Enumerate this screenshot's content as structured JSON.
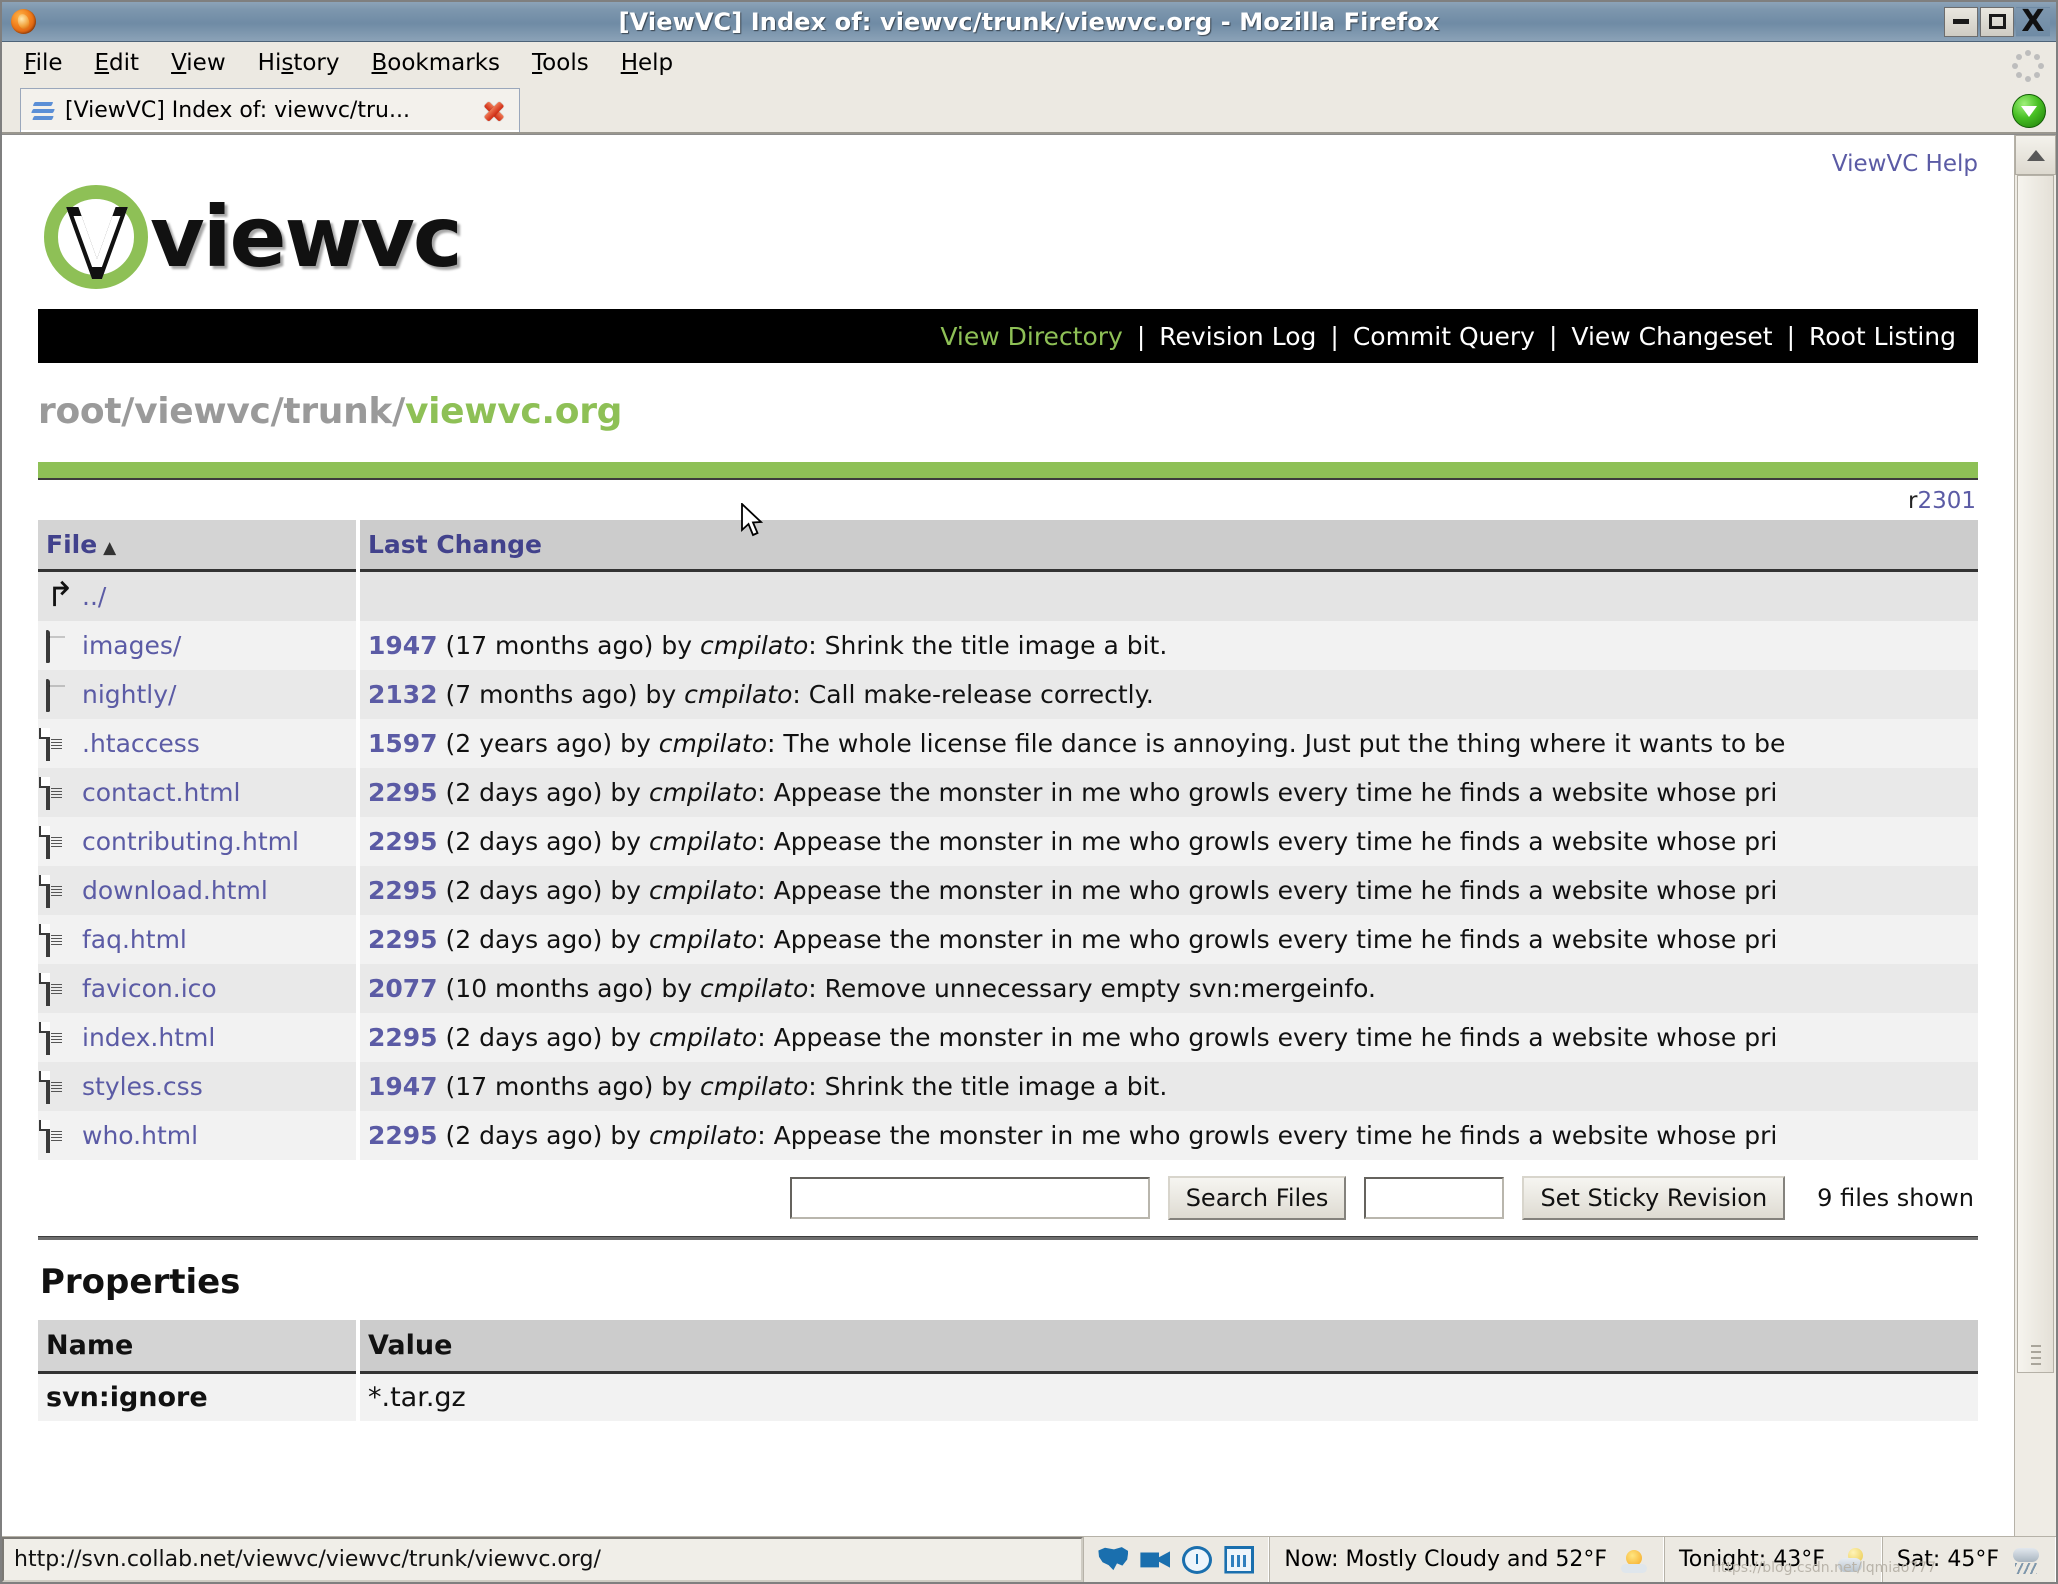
{
  "window": {
    "title": "[ViewVC] Index of: viewvc/trunk/viewvc.org - Mozilla Firefox",
    "minimize_label": "Minimize",
    "maximize_label": "Maximize",
    "close_label": "X"
  },
  "menubar": [
    {
      "label": "File",
      "accel": "F"
    },
    {
      "label": "Edit",
      "accel": "E"
    },
    {
      "label": "View",
      "accel": "V"
    },
    {
      "label": "History",
      "accel": "s"
    },
    {
      "label": "Bookmarks",
      "accel": "B"
    },
    {
      "label": "Tools",
      "accel": "T"
    },
    {
      "label": "Help",
      "accel": "H"
    }
  ],
  "tab": {
    "title": "[ViewVC] Index of: viewvc/tru...",
    "favicon": "viewvc-favicon",
    "close": "close-icon"
  },
  "page": {
    "help_link": "ViewVC Help",
    "logo_text": "viewvc",
    "nav": [
      {
        "label": "View Directory",
        "active": true
      },
      {
        "label": "Revision Log",
        "active": false
      },
      {
        "label": "Commit Query",
        "active": false
      },
      {
        "label": "View Changeset",
        "active": false
      },
      {
        "label": "Root Listing",
        "active": false
      }
    ],
    "nav_separator": "|",
    "breadcrumb_prefix": "root/viewvc/trunk/",
    "breadcrumb_current": "viewvc.org",
    "revision_prefix": "r",
    "revision_number": "2301",
    "table": {
      "headers": {
        "file": "File",
        "last_change": "Last Change"
      },
      "sort_arrow": "▲",
      "rows": [
        {
          "icon": "back-arrow-icon",
          "name": "../",
          "revision": "",
          "age": "",
          "author": "",
          "message": "",
          "is_parent": true
        },
        {
          "icon": "folder-icon",
          "name": "images/",
          "revision": "1947",
          "age": "(17 months ago)",
          "by": "by",
          "author": "cmpilato",
          "message": ": Shrink the title image a bit."
        },
        {
          "icon": "folder-icon",
          "name": "nightly/",
          "revision": "2132",
          "age": "(7 months ago)",
          "by": "by",
          "author": "cmpilato",
          "message": ": Call make-release correctly."
        },
        {
          "icon": "file-icon",
          "name": ".htaccess",
          "revision": "1597",
          "age": "(2 years ago)",
          "by": "by",
          "author": "cmpilato",
          "message": ": The whole license file dance is annoying. Just put the thing where it wants to be"
        },
        {
          "icon": "file-icon",
          "name": "contact.html",
          "revision": "2295",
          "age": "(2 days ago)",
          "by": "by",
          "author": "cmpilato",
          "message": ": Appease the monster in me who growls every time he finds a website whose pri"
        },
        {
          "icon": "file-icon",
          "name": "contributing.html",
          "revision": "2295",
          "age": "(2 days ago)",
          "by": "by",
          "author": "cmpilato",
          "message": ": Appease the monster in me who growls every time he finds a website whose pri"
        },
        {
          "icon": "file-icon",
          "name": "download.html",
          "revision": "2295",
          "age": "(2 days ago)",
          "by": "by",
          "author": "cmpilato",
          "message": ": Appease the monster in me who growls every time he finds a website whose pri"
        },
        {
          "icon": "file-icon",
          "name": "faq.html",
          "revision": "2295",
          "age": "(2 days ago)",
          "by": "by",
          "author": "cmpilato",
          "message": ": Appease the monster in me who growls every time he finds a website whose pri"
        },
        {
          "icon": "file-icon",
          "name": "favicon.ico",
          "revision": "2077",
          "age": "(10 months ago)",
          "by": "by",
          "author": "cmpilato",
          "message": ": Remove unnecessary empty svn:mergeinfo."
        },
        {
          "icon": "file-icon",
          "name": "index.html",
          "revision": "2295",
          "age": "(2 days ago)",
          "by": "by",
          "author": "cmpilato",
          "message": ": Appease the monster in me who growls every time he finds a website whose pri"
        },
        {
          "icon": "file-icon",
          "name": "styles.css",
          "revision": "1947",
          "age": "(17 months ago)",
          "by": "by",
          "author": "cmpilato",
          "message": ": Shrink the title image a bit."
        },
        {
          "icon": "file-icon",
          "name": "who.html",
          "revision": "2295",
          "age": "(2 days ago)",
          "by": "by",
          "author": "cmpilato",
          "message": ": Appease the monster in me who growls every time he finds a website whose pri"
        }
      ]
    },
    "search": {
      "query_value": "",
      "query_placeholder": "",
      "search_button": "Search Files",
      "sticky_value": "",
      "sticky_button": "Set Sticky Revision",
      "files_shown": "9 files shown"
    },
    "properties": {
      "title": "Properties",
      "headers": {
        "name": "Name",
        "value": "Value"
      },
      "rows": [
        {
          "name": "svn:ignore",
          "value": "*.tar.gz"
        }
      ]
    }
  },
  "statusbar": {
    "url": "http://svn.collab.net/viewvc/viewvc/trunk/viewvc.org/",
    "tool_icons": [
      "us-map-icon",
      "video-camera-icon",
      "clock-icon",
      "chart-icon"
    ],
    "weather": [
      {
        "text": "Now: Mostly Cloudy and 52°F",
        "icon": "sun-cloud-icon"
      },
      {
        "text": "Tonight: 43°F",
        "icon": "night-cloud-icon"
      },
      {
        "text": "Sat: 45°F",
        "icon": "rain-icon"
      }
    ],
    "watermark": "https://blog.csdn.net/lqmiao777"
  },
  "colors": {
    "accent_green": "#8ec056",
    "link": "#5b5ba5",
    "nav_bg": "#000000",
    "header_bg": "#cccccc",
    "titlebar": "#7e97ae"
  }
}
